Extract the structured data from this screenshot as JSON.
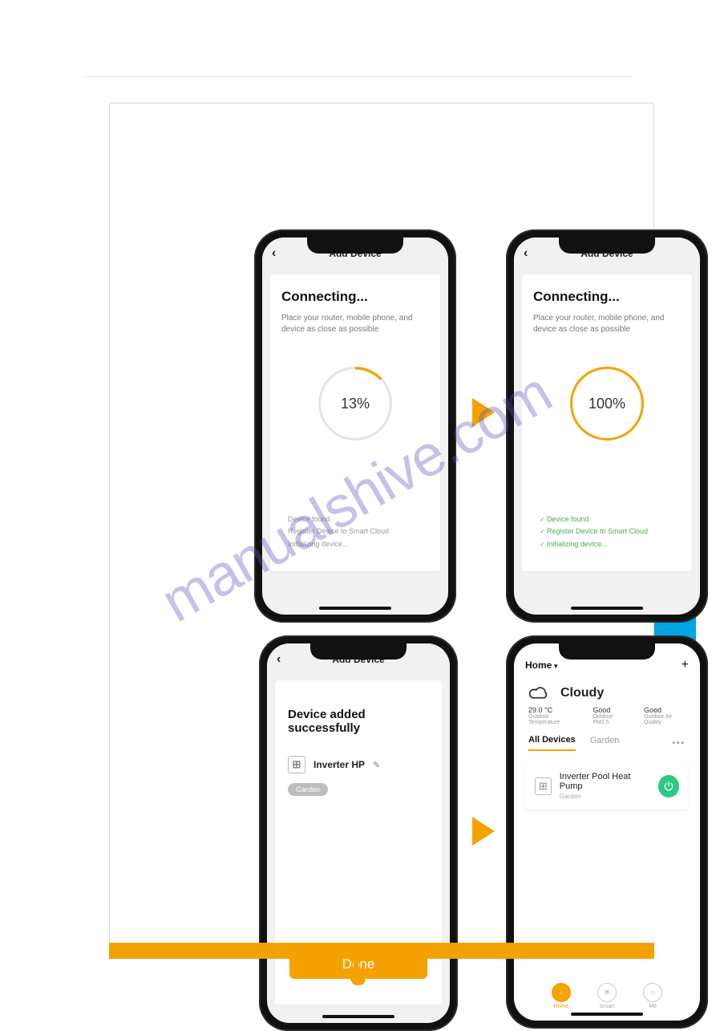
{
  "watermark": "manualshive.com",
  "screens": {
    "s1": {
      "nav_title": "Add Device",
      "heading": "Connecting...",
      "subtext": "Place your router, mobile phone, and device as close as possible",
      "progress": "13%",
      "steps": {
        "found": "Device found",
        "register": "Register Device to Smart Cloud",
        "init": "Initializing device..."
      }
    },
    "s2": {
      "nav_title": "Add Device",
      "heading": "Connecting...",
      "subtext": "Place your router, mobile phone, and device as close as possible",
      "progress": "100%",
      "steps": {
        "found": "Device found",
        "register": "Register Device to Smart Cloud",
        "init": "Initializing device..."
      }
    },
    "s3": {
      "nav_title": "Add Device",
      "heading": "Device added successfully",
      "device_name": "Inverter HP",
      "room_chip": "Garden",
      "done_label": "Done"
    },
    "s4": {
      "home_label": "Home",
      "weather": "Cloudy",
      "metrics": {
        "temp_value": "29.0 °C",
        "temp_label": "Outdoor Temperature",
        "pm_value": "Good",
        "pm_label": "Outdoor PM2.5",
        "air_value": "Good",
        "air_label": "Outdoor Air Quality"
      },
      "tabs": {
        "all": "All Devices",
        "garden": "Garden"
      },
      "device": {
        "name": "Inverter Pool Heat Pump",
        "room": "Garden"
      },
      "tabbar": {
        "home": "Home",
        "smart": "Smart",
        "me": "Me"
      }
    }
  }
}
